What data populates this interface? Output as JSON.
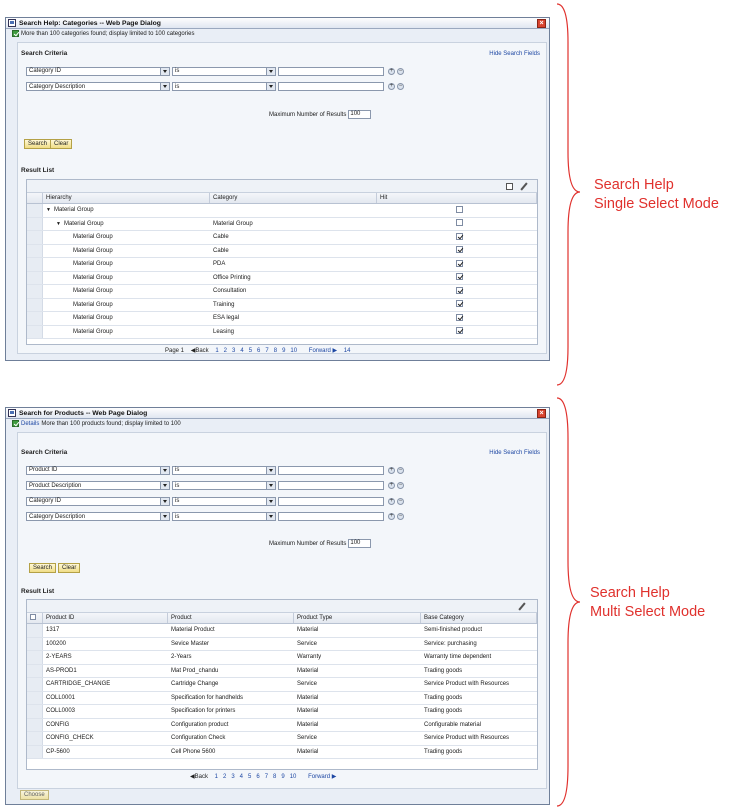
{
  "dialog_single": {
    "title": "Search Help: Categories -- Web Page Dialog",
    "message": "More than 100 categories found; display limited to 100 categories",
    "search_criteria_title": "Search Criteria",
    "hide_search_fields": "Hide Search Fields",
    "criteria": [
      {
        "field": "Category ID",
        "operator": "is",
        "value": ""
      },
      {
        "field": "Category Description",
        "operator": "is",
        "value": ""
      }
    ],
    "max_results_label": "Maximum Number of Results",
    "max_results_value": "100",
    "search_button": "Search",
    "clear_button": "Clear",
    "result_list_title": "Result List",
    "columns": [
      "Hierarchy",
      "Category",
      "Hit"
    ],
    "rows": [
      {
        "hierarchy": "Material Group",
        "category": "",
        "level": 0,
        "expanded": true,
        "hit": false
      },
      {
        "hierarchy": "Material Group",
        "category": "Material Group",
        "level": 1,
        "expanded": true,
        "hit": false
      },
      {
        "hierarchy": "Material Group",
        "category": "Cable",
        "level": 2,
        "hit": true
      },
      {
        "hierarchy": "Material Group",
        "category": "Cable",
        "level": 2,
        "hit": true
      },
      {
        "hierarchy": "Material Group",
        "category": "PDA",
        "level": 2,
        "hit": true
      },
      {
        "hierarchy": "Material Group",
        "category": "Office Printing",
        "level": 2,
        "hit": true
      },
      {
        "hierarchy": "Material Group",
        "category": "Consultation",
        "level": 2,
        "hit": true
      },
      {
        "hierarchy": "Material Group",
        "category": "Training",
        "level": 2,
        "hit": true
      },
      {
        "hierarchy": "Material Group",
        "category": "ESA legal",
        "level": 2,
        "hit": true
      },
      {
        "hierarchy": "Material Group",
        "category": "Leasing",
        "level": 2,
        "hit": true
      }
    ],
    "pager": {
      "page_label": "Page 1",
      "back": "◀Back",
      "pages": [
        "1",
        "2",
        "3",
        "4",
        "5",
        "6",
        "7",
        "8",
        "9",
        "10"
      ],
      "forward": "Forward ▶",
      "last": "14"
    }
  },
  "dialog_multi": {
    "title": "Search for Products -- Web Page Dialog",
    "message_link": "Details",
    "message": "More than 100 products found; display limited to 100",
    "search_criteria_title": "Search Criteria",
    "hide_search_fields": "Hide Search Fields",
    "criteria": [
      {
        "field": "Product ID",
        "operator": "is",
        "value": ""
      },
      {
        "field": "Product Description",
        "operator": "is",
        "value": ""
      },
      {
        "field": "Category ID",
        "operator": "is",
        "value": ""
      },
      {
        "field": "Category Description",
        "operator": "is",
        "value": ""
      }
    ],
    "max_results_label": "Maximum Number of Results",
    "max_results_value": "100",
    "search_button": "Search",
    "clear_button": "Clear",
    "result_list_title": "Result List",
    "columns": [
      "Product ID",
      "Product",
      "Product Type",
      "Base Category"
    ],
    "rows": [
      {
        "id": "1317",
        "product": "Material Product",
        "type": "Material",
        "category": "Semi-finished product"
      },
      {
        "id": "100200",
        "product": "Sevice Master",
        "type": "Service",
        "category": "Service: purchasing"
      },
      {
        "id": "2-YEARS",
        "product": "2-Years",
        "type": "Warranty",
        "category": "Warranty time dependent"
      },
      {
        "id": "AS-PROD1",
        "product": "Mat Prod_chandu",
        "type": "Material",
        "category": "Trading goods"
      },
      {
        "id": "CARTRIDGE_CHANGE",
        "product": "Cartridge Change",
        "type": "Service",
        "category": "Service Product with Resources"
      },
      {
        "id": "COLL0001",
        "product": "Specification for handhelds",
        "type": "Material",
        "category": "Trading goods"
      },
      {
        "id": "COLL0003",
        "product": "Specification for printers",
        "type": "Material",
        "category": "Trading goods"
      },
      {
        "id": "CONFIG",
        "product": "Configuration product",
        "type": "Material",
        "category": "Configurable material"
      },
      {
        "id": "CONFIG_CHECK",
        "product": "Configuration Check",
        "type": "Service",
        "category": "Service Product with Resources"
      },
      {
        "id": "CP-5600",
        "product": "Cell Phone 5600",
        "type": "Material",
        "category": "Trading goods"
      }
    ],
    "pager": {
      "back": "◀Back",
      "pages": [
        "1",
        "2",
        "3",
        "4",
        "5",
        "6",
        "7",
        "8",
        "9",
        "10"
      ],
      "forward": "Forward ▶"
    },
    "choose_button": "Choose"
  },
  "annotations": {
    "single": [
      "Search Help",
      "Single Select Mode"
    ],
    "multi": [
      "Search Help",
      "Multi Select Mode"
    ]
  },
  "colors": {
    "annotation": "#e0312d",
    "link": "#1d47a3",
    "button_fill": "#f0dd86"
  }
}
